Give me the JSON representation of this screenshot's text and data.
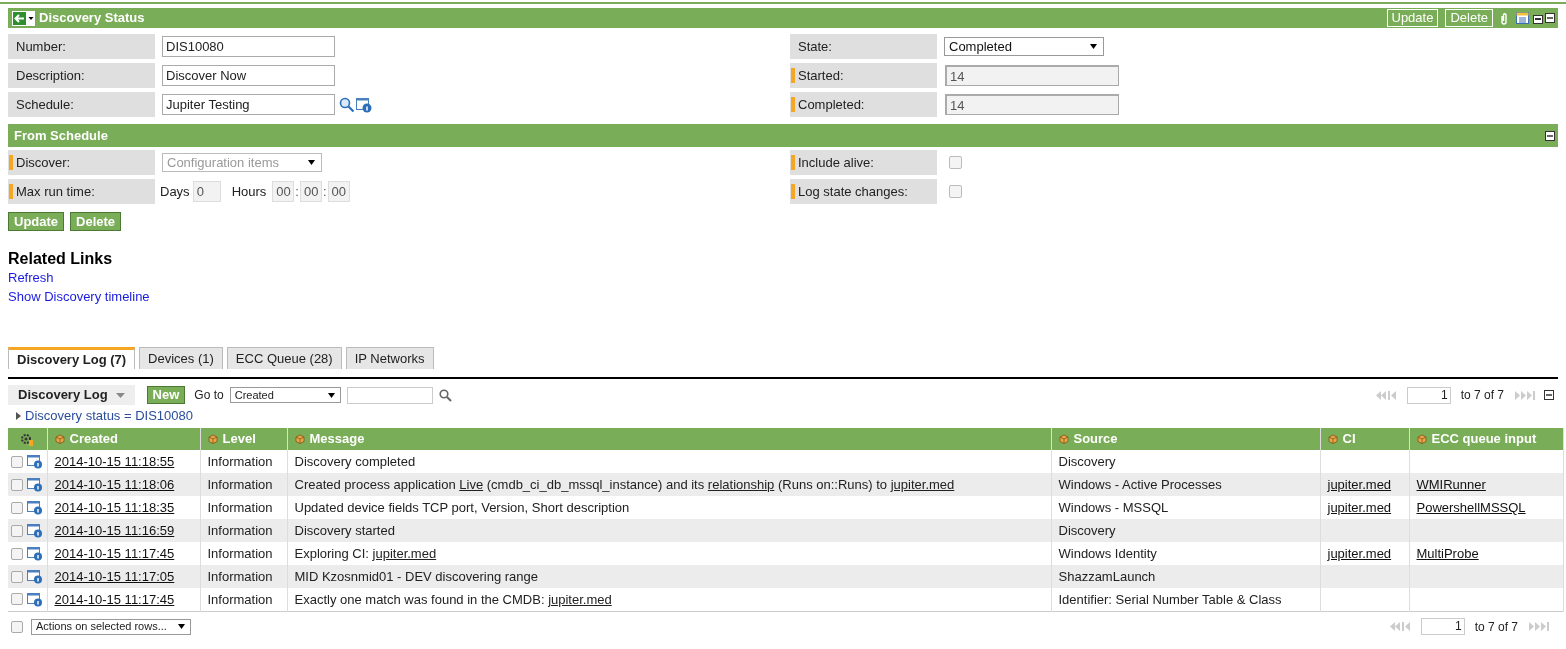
{
  "header": {
    "title": "Discovery Status",
    "buttons": [
      "Update",
      "Delete"
    ]
  },
  "main_fields": {
    "left": [
      {
        "label": "Number:",
        "kind": "text",
        "value": "DIS10080",
        "mandatory": false
      },
      {
        "label": "Description:",
        "kind": "text",
        "value": "Discover Now",
        "mandatory": false
      },
      {
        "label": "Schedule:",
        "kind": "reference",
        "value": "Jupiter Testing",
        "mandatory": false
      }
    ],
    "right": [
      {
        "label": "State:",
        "kind": "select",
        "value": "Completed",
        "mandatory": false
      },
      {
        "label": "Started:",
        "kind": "readonly",
        "value": "14",
        "mandatory": true
      },
      {
        "label": "Completed:",
        "kind": "readonly",
        "value": "14",
        "mandatory": true
      }
    ]
  },
  "section": {
    "title": "From Schedule",
    "left": [
      {
        "label": "Discover:",
        "kind": "select_disabled",
        "value": "Configuration items",
        "mandatory": true
      },
      {
        "label": "Max run time:",
        "kind": "duration",
        "days_label": "Days",
        "days": "0",
        "hours_label": "Hours",
        "hours": [
          "00",
          "00",
          "00"
        ],
        "separator": ":",
        "mandatory": true
      }
    ],
    "right": [
      {
        "label": "Include alive:",
        "kind": "checkbox",
        "checked": false,
        "mandatory": true
      },
      {
        "label": "Log state changes:",
        "kind": "checkbox",
        "checked": false,
        "mandatory": true
      }
    ]
  },
  "form_buttons": [
    "Update",
    "Delete"
  ],
  "related_links": {
    "title": "Related Links",
    "links": [
      "Refresh",
      "Show Discovery timeline"
    ]
  },
  "tabs": [
    {
      "label": "Discovery Log (7)",
      "selected": true
    },
    {
      "label": "Devices (1)",
      "selected": false
    },
    {
      "label": "ECC Queue (28)",
      "selected": false
    },
    {
      "label": "IP Networks",
      "selected": false
    }
  ],
  "list": {
    "title": "Discovery Log",
    "new_button": "New",
    "goto_label": "Go to",
    "goto_value": "Created",
    "pager": {
      "page": "1",
      "range": "to 7 of 7"
    },
    "filter": "Discovery status = DIS10080",
    "columns": [
      "Created",
      "Level",
      "Message",
      "Source",
      "CI",
      "ECC queue input"
    ],
    "rows": [
      {
        "checked": false,
        "created": "2014-10-15 11:18:55",
        "level": "Information",
        "message": [
          {
            "text": "Discovery completed",
            "link": false
          }
        ],
        "source": "Discovery"
      },
      {
        "checked": false,
        "created": "2014-10-15 11:18:06",
        "level": "Information",
        "message": [
          {
            "text": "Created process application ",
            "link": false
          },
          {
            "text": "Live",
            "link": true
          },
          {
            "text": " (cmdb_ci_db_mssql_instance) and its ",
            "link": false
          },
          {
            "text": "relationship",
            "link": true
          },
          {
            "text": " (Runs on::Runs) to ",
            "link": false
          },
          {
            "text": "jupiter.med",
            "link": true
          }
        ],
        "source": "Windows - Active Processes",
        "ci": "jupiter.med",
        "ecc": "WMIRunner"
      },
      {
        "checked": false,
        "created": "2014-10-15 11:18:35",
        "level": "Information",
        "message": [
          {
            "text": "Updated device fields TCP port, Version, Short description",
            "link": false
          }
        ],
        "source": "Windows - MSSQL",
        "ci": "jupiter.med",
        "ecc": "PowershellMSSQL"
      },
      {
        "checked": false,
        "created": "2014-10-15 11:16:59",
        "level": "Information",
        "message": [
          {
            "text": "Discovery started",
            "link": false
          }
        ],
        "source": "Discovery"
      },
      {
        "checked": false,
        "created": "2014-10-15 11:17:45",
        "level": "Information",
        "message": [
          {
            "text": "Exploring CI: ",
            "link": false
          },
          {
            "text": "jupiter.med",
            "link": true
          }
        ],
        "source": "Windows Identity",
        "ci": "jupiter.med",
        "ecc": "MultiProbe"
      },
      {
        "checked": false,
        "created": "2014-10-15 11:17:05",
        "level": "Information",
        "message": [
          {
            "text": "MID Kzosnmid01 - DEV discovering range",
            "link": false
          }
        ],
        "source": "ShazzamLaunch"
      },
      {
        "checked": false,
        "created": "2014-10-15 11:17:45",
        "level": "Information",
        "message": [
          {
            "text": "Exactly one match was found in the CMDB: ",
            "link": false
          },
          {
            "text": "jupiter.med",
            "link": true
          }
        ],
        "source": "Identifier: Serial Number Table & Class"
      }
    ],
    "footer": {
      "select_all_checked": false,
      "actions": "Actions on selected rows...",
      "pager": {
        "page": "1",
        "range": "to 7 of 7"
      }
    }
  }
}
